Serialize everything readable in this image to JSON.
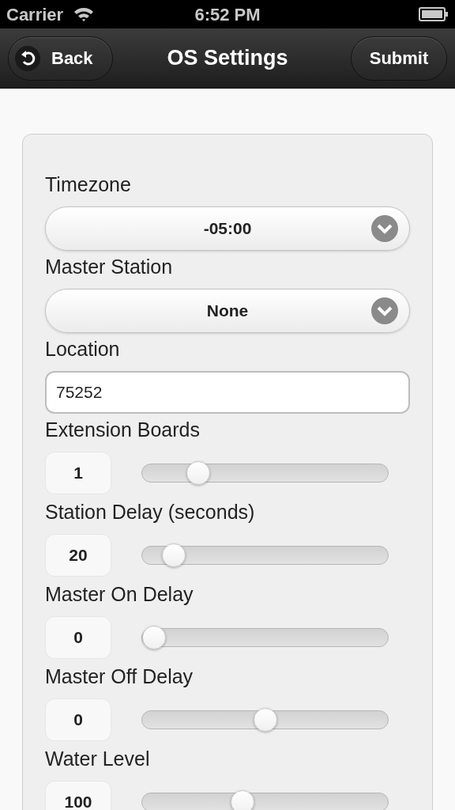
{
  "status_bar": {
    "carrier": "Carrier",
    "time": "6:52 PM"
  },
  "header": {
    "back": "Back",
    "title": "OS Settings",
    "submit": "Submit"
  },
  "fields": [
    {
      "kind": "select",
      "label": "Timezone",
      "value": "-05:00"
    },
    {
      "kind": "select",
      "label": "Master Station",
      "value": "None"
    },
    {
      "kind": "text",
      "label": "Location",
      "value": "75252"
    },
    {
      "kind": "slider",
      "label": "Extension Boards",
      "value": "1",
      "level": 0.2
    },
    {
      "kind": "slider",
      "label": "Station Delay (seconds)",
      "value": "20",
      "level": 0.09
    },
    {
      "kind": "slider",
      "label": "Master On Delay",
      "value": "0",
      "level": 0
    },
    {
      "kind": "slider",
      "label": "Master Off Delay",
      "value": "0",
      "level": 0.5
    },
    {
      "kind": "slider",
      "label": "Water Level",
      "value": "100",
      "level": 0.4
    }
  ]
}
